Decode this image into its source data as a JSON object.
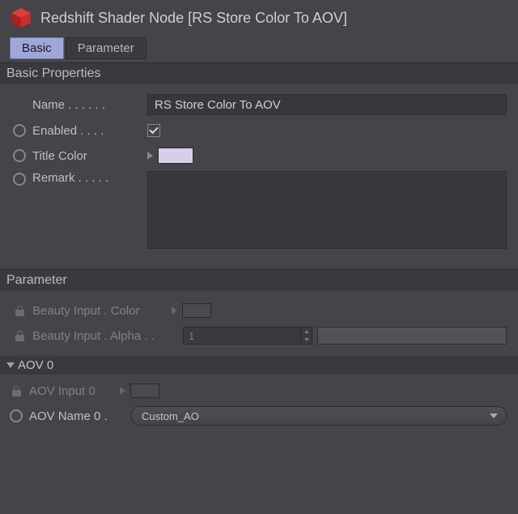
{
  "header": {
    "title": "Redshift Shader Node [RS Store Color To AOV]",
    "icon_color_top": "#e23b3b",
    "icon_color_side": "#b01f1f",
    "icon_color_front": "#c92c2c"
  },
  "tabs": {
    "basic": "Basic",
    "parameter": "Parameter",
    "active": "basic"
  },
  "sections": {
    "basic_title": "Basic Properties",
    "param_title": "Parameter"
  },
  "basic": {
    "name_label": "Name . . . . . .",
    "name_value": "RS Store Color To AOV",
    "enabled_label": "Enabled . . . .",
    "enabled_value": true,
    "titlecolor_label": "Title Color",
    "titlecolor_value": "#d6cfe6",
    "remark_label": "Remark . . . . .",
    "remark_value": ""
  },
  "param": {
    "beauty_color_label": "Beauty Input . Color",
    "beauty_alpha_label": "Beauty Input . Alpha . .",
    "beauty_alpha_value": "1",
    "aov0_group": "AOV 0",
    "aov_input0_label": "AOV Input 0",
    "aov_name0_label": "AOV Name 0 .",
    "aov_name0_value": "Custom_AO"
  }
}
